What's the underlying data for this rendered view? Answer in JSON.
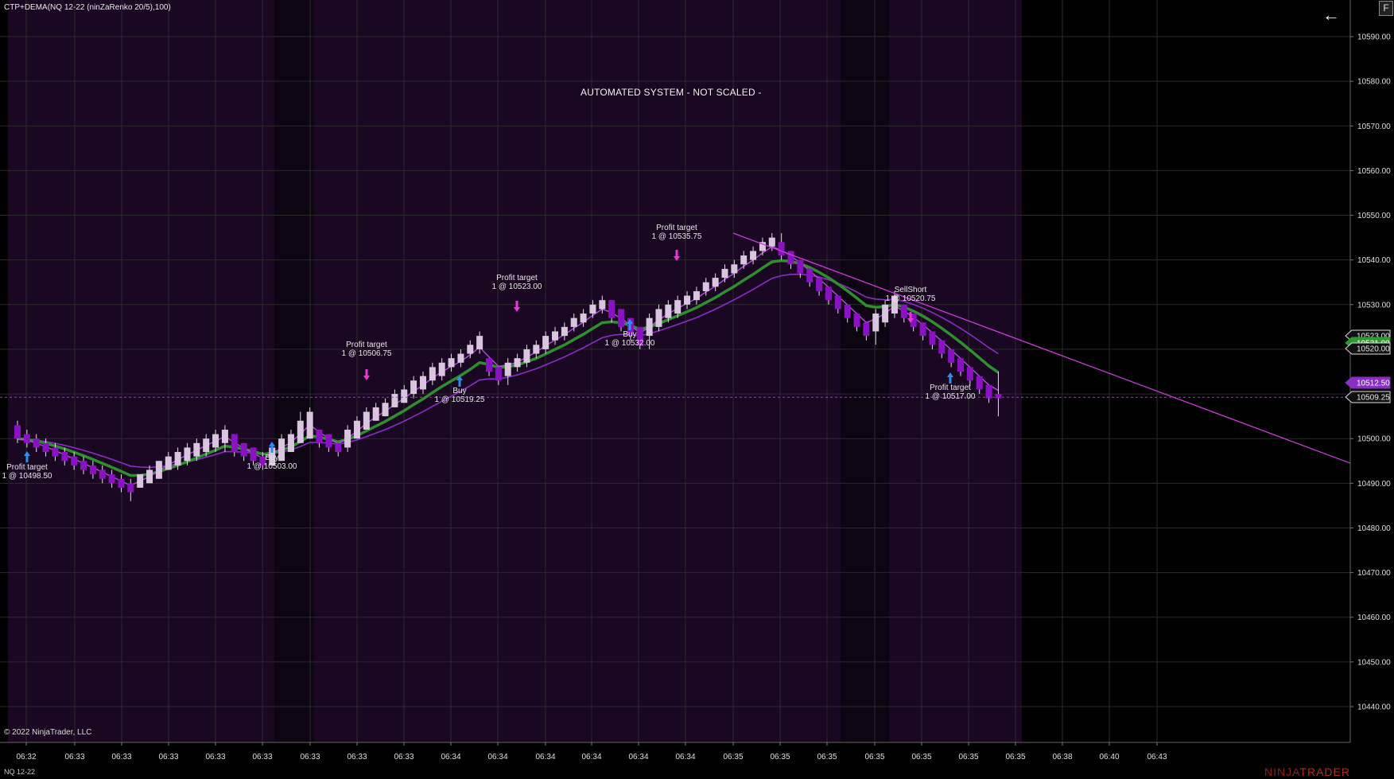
{
  "chart_title": "CTP+DEMA(NQ 12-22 (ninZaRenko 20/5),100)",
  "notice": "AUTOMATED SYSTEM - NOT SCALED -",
  "copyright": "© 2022 NinjaTrader, LLC",
  "instrument": "NQ 12-22",
  "logo": {
    "prefix": "NINJA",
    "suffix": "TRADER"
  },
  "buttons": {
    "back_icon": "arrow-left-icon",
    "f_label": "F"
  },
  "colors": {
    "background": "#000000",
    "session_shade": "#1a0722",
    "bull_candle": "#d9c6de",
    "bear_candle": "#8a12c2",
    "dema": "#2f8f2f",
    "fast_ma": "#b84de0",
    "slow_ma": "#8a2ec8",
    "trend_line": "#c83ad8"
  },
  "chart_data": {
    "type": "candlestick",
    "y_axis": {
      "min": 10435,
      "max": 10595,
      "ticks": [
        "10590.00",
        "10580.00",
        "10570.00",
        "10560.00",
        "10550.00",
        "10540.00",
        "10530.00",
        "10520.00",
        "10510.00",
        "10500.00",
        "10490.00",
        "10480.00",
        "10470.00",
        "10460.00",
        "10450.00",
        "10440.00"
      ]
    },
    "x_axis": {
      "tick_labels": [
        "06:32",
        "06:33",
        "06:33",
        "06:33",
        "06:33",
        "06:33",
        "06:33",
        "06:33",
        "06:33",
        "06:34",
        "06:34",
        "06:34",
        "06:34",
        "06:34",
        "06:34",
        "06:35",
        "06:35",
        "06:35",
        "06:35",
        "06:35",
        "06:35",
        "06:35",
        "06:38",
        "06:40",
        "06:43"
      ]
    },
    "price_markers": [
      {
        "value": "10523.00",
        "style": "white"
      },
      {
        "value": "10521.00",
        "style": "green"
      },
      {
        "value": "10520.00",
        "style": "white"
      },
      {
        "value": "10512.50",
        "style": "purple"
      },
      {
        "value": "10509.25",
        "style": "white"
      }
    ],
    "current_price_line": 10509.25,
    "trade_annotations": [
      {
        "label": "Profit target",
        "detail": "1 @ 10498.50",
        "side": "buy"
      },
      {
        "label": "Profit target",
        "detail": "1 @ 10506.75",
        "side": "sell"
      },
      {
        "label": "Buy",
        "detail": "1 @ 10503.00",
        "side": "buy"
      },
      {
        "label": "Buy",
        "detail": "1 @ 10519.25",
        "side": "buy"
      },
      {
        "label": "Profit target",
        "detail": "1 @ 10523.00",
        "side": "sell"
      },
      {
        "label": "Buy",
        "detail": "1 @ 10532.00",
        "side": "buy"
      },
      {
        "label": "Profit target",
        "detail": "1 @ 10535.75",
        "side": "sell"
      },
      {
        "label": "SellShort",
        "detail": "1 @ 10520.75",
        "side": "sell"
      },
      {
        "label": "Profit target",
        "detail": "1 @ 10517.00",
        "side": "buy"
      }
    ],
    "candles": [
      [
        10503,
        10504,
        10499,
        10500
      ],
      [
        10501,
        10502,
        10498,
        10499
      ],
      [
        10500,
        10501,
        10497,
        10498
      ],
      [
        10499,
        10500,
        10496,
        10497
      ],
      [
        10498,
        10499,
        10495,
        10496
      ],
      [
        10497,
        10498,
        10494,
        10495
      ],
      [
        10496,
        10497,
        10493,
        10494
      ],
      [
        10495,
        10496,
        10492,
        10493
      ],
      [
        10494,
        10495,
        10491,
        10492
      ],
      [
        10493,
        10494,
        10490,
        10491
      ],
      [
        10492,
        10493,
        10489,
        10490
      ],
      [
        10491,
        10492,
        10488,
        10489
      ],
      [
        10490,
        10491,
        10486,
        10488
      ],
      [
        10489,
        10492,
        10489,
        10492
      ],
      [
        10490,
        10494,
        10490,
        10493
      ],
      [
        10491,
        10495,
        10491,
        10495
      ],
      [
        10493,
        10497,
        10493,
        10496
      ],
      [
        10494,
        10498,
        10493,
        10497
      ],
      [
        10495,
        10499,
        10494,
        10498
      ],
      [
        10496,
        10500,
        10495,
        10499
      ],
      [
        10497,
        10501,
        10496,
        10500
      ],
      [
        10498,
        10502,
        10497,
        10501
      ],
      [
        10499,
        10503,
        10497,
        10502
      ],
      [
        10501,
        10501,
        10496,
        10497
      ],
      [
        10499,
        10499,
        10495,
        10496
      ],
      [
        10498,
        10498,
        10494,
        10495
      ],
      [
        10496,
        10497,
        10493,
        10494
      ],
      [
        10494,
        10499,
        10494,
        10498
      ],
      [
        10495,
        10501,
        10495,
        10500
      ],
      [
        10497,
        10502,
        10497,
        10501
      ],
      [
        10499,
        10506,
        10499,
        10504
      ],
      [
        10500,
        10507,
        10500,
        10506
      ],
      [
        10502,
        10502,
        10498,
        10499
      ],
      [
        10501,
        10501,
        10497,
        10498
      ],
      [
        10499,
        10499,
        10496,
        10497
      ],
      [
        10498,
        10503,
        10497,
        10502
      ],
      [
        10500,
        10505,
        10500,
        10504
      ],
      [
        10502,
        10507,
        10502,
        10506
      ],
      [
        10504,
        10508,
        10504,
        10507
      ],
      [
        10505,
        10509,
        10505,
        10508
      ],
      [
        10507,
        10511,
        10507,
        10510
      ],
      [
        10508,
        10512,
        10508,
        10511
      ],
      [
        10510,
        10514,
        10509,
        10513
      ],
      [
        10511,
        10515,
        10510,
        10514
      ],
      [
        10513,
        10517,
        10512,
        10516
      ],
      [
        10514,
        10518,
        10513,
        10517
      ],
      [
        10516,
        10519,
        10515,
        10518
      ],
      [
        10517,
        10520,
        10516,
        10519
      ],
      [
        10519,
        10522,
        10518,
        10521
      ],
      [
        10520,
        10524,
        10519,
        10523
      ],
      [
        10518,
        10518,
        10514,
        10515
      ],
      [
        10516,
        10516,
        10512,
        10513
      ],
      [
        10514,
        10518,
        10512,
        10517
      ],
      [
        10516,
        10519,
        10515,
        10518
      ],
      [
        10517,
        10521,
        10516,
        10520
      ],
      [
        10519,
        10522,
        10518,
        10521
      ],
      [
        10520,
        10524,
        10519,
        10523
      ],
      [
        10522,
        10525,
        10521,
        10524
      ],
      [
        10523,
        10526,
        10522,
        10525
      ],
      [
        10525,
        10528,
        10524,
        10527
      ],
      [
        10526,
        10529,
        10525,
        10528
      ],
      [
        10528,
        10531,
        10527,
        10530
      ],
      [
        10529,
        10532,
        10528,
        10531
      ],
      [
        10531,
        10531,
        10526,
        10527
      ],
      [
        10529,
        10529,
        10524,
        10525
      ],
      [
        10527,
        10527,
        10522,
        10523
      ],
      [
        10525,
        10525,
        10520,
        10521
      ],
      [
        10523,
        10528,
        10520,
        10527
      ],
      [
        10525,
        10530,
        10524,
        10529
      ],
      [
        10527,
        10531,
        10526,
        10530
      ],
      [
        10528,
        10532,
        10527,
        10531
      ],
      [
        10530,
        10533,
        10529,
        10532
      ],
      [
        10531,
        10534,
        10530,
        10533
      ],
      [
        10533,
        10536,
        10532,
        10535
      ],
      [
        10534,
        10537,
        10533,
        10536
      ],
      [
        10536,
        10539,
        10535,
        10538
      ],
      [
        10537,
        10540,
        10536,
        10539
      ],
      [
        10539,
        10542,
        10538,
        10541
      ],
      [
        10540,
        10543,
        10539,
        10542
      ],
      [
        10542,
        10545,
        10541,
        10544
      ],
      [
        10543,
        10546,
        10542,
        10545
      ],
      [
        10544,
        10546,
        10540,
        10541
      ],
      [
        10542,
        10542,
        10538,
        10539
      ],
      [
        10540,
        10540,
        10536,
        10537
      ],
      [
        10538,
        10538,
        10534,
        10535
      ],
      [
        10536,
        10536,
        10532,
        10533
      ],
      [
        10534,
        10534,
        10530,
        10531
      ],
      [
        10532,
        10532,
        10528,
        10529
      ],
      [
        10530,
        10530,
        10526,
        10527
      ],
      [
        10528,
        10528,
        10524,
        10525
      ],
      [
        10526,
        10526,
        10522,
        10523
      ],
      [
        10524,
        10529,
        10521,
        10528
      ],
      [
        10526,
        10531,
        10525,
        10530
      ],
      [
        10528,
        10533,
        10527,
        10532
      ],
      [
        10530,
        10530,
        10526,
        10527
      ],
      [
        10528,
        10528,
        10524,
        10525
      ],
      [
        10526,
        10526,
        10522,
        10523
      ],
      [
        10524,
        10524,
        10520,
        10521
      ],
      [
        10522,
        10522,
        10518,
        10519
      ],
      [
        10520,
        10520,
        10516,
        10517
      ],
      [
        10518,
        10518,
        10514,
        10515
      ],
      [
        10516,
        10516,
        10512,
        10513
      ],
      [
        10514,
        10514,
        10510,
        10511
      ],
      [
        10512,
        10512,
        10508,
        10509
      ],
      [
        10510,
        10515,
        10505,
        10509
      ]
    ]
  }
}
